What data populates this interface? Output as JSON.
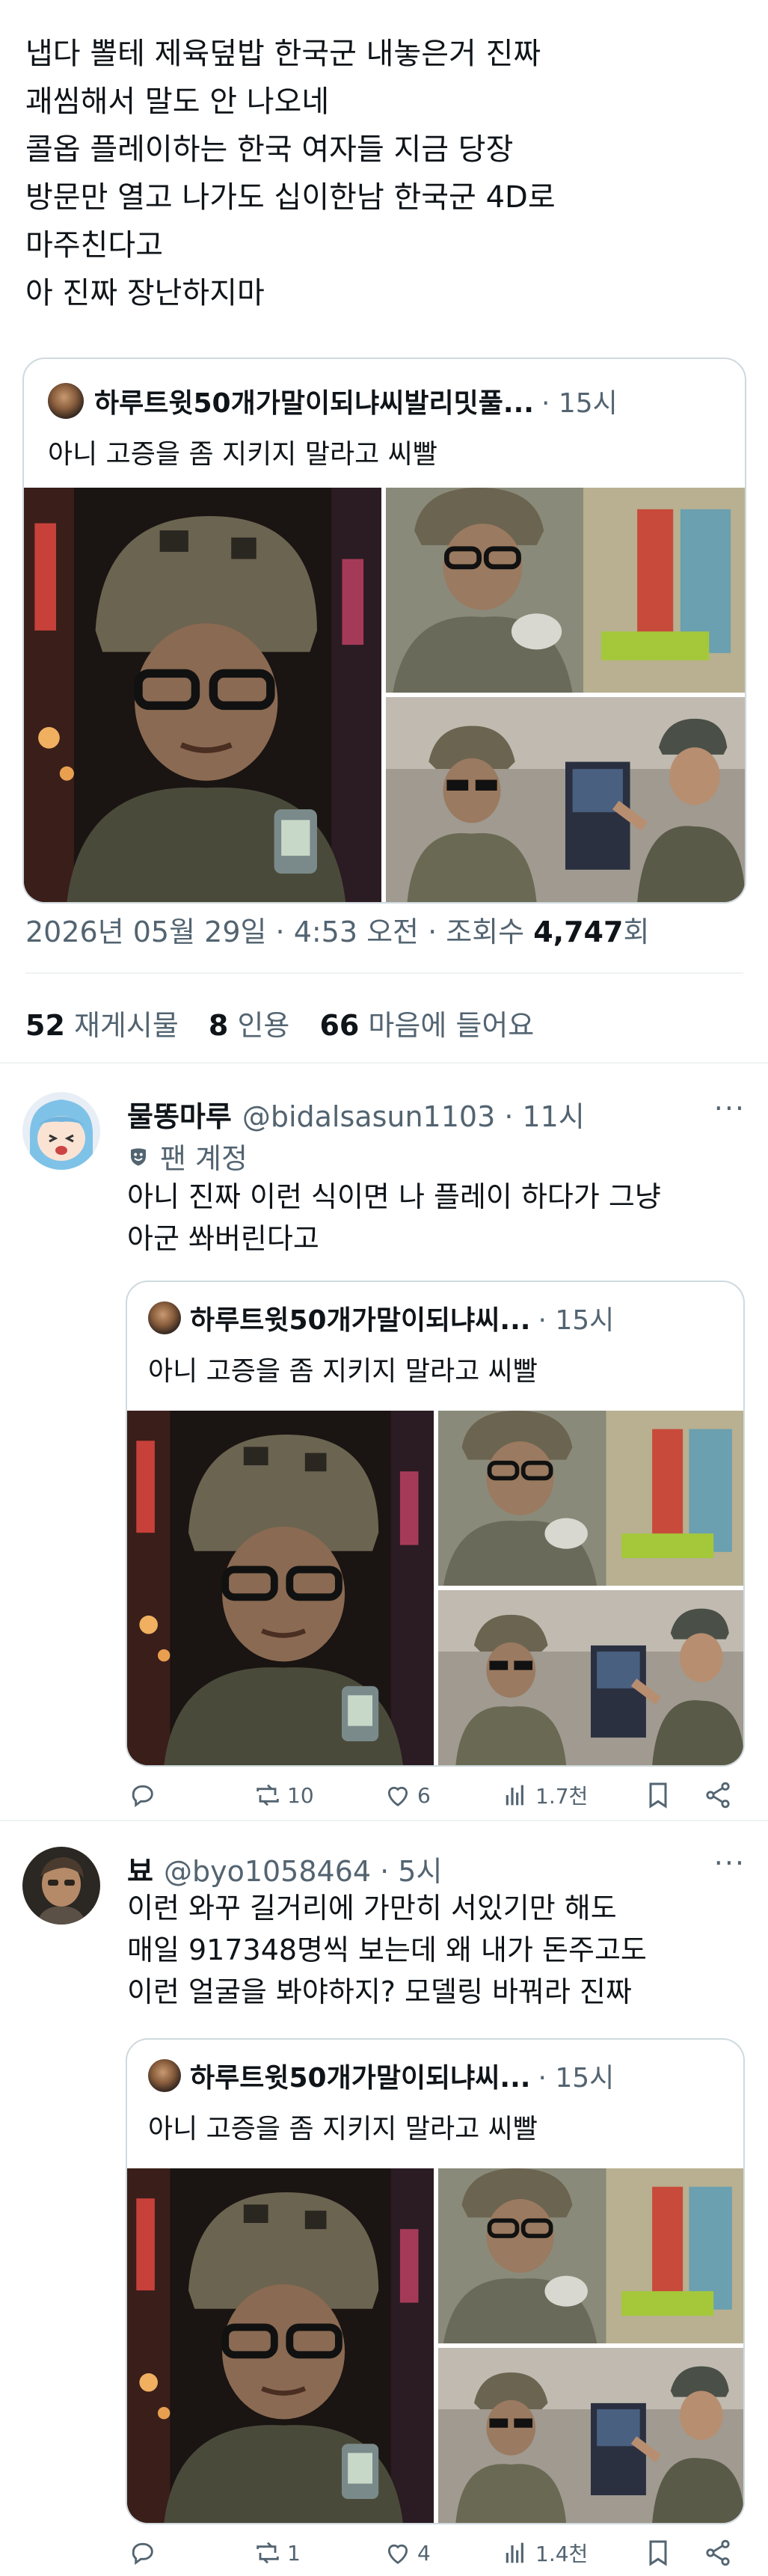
{
  "main_post": {
    "text_lines": [
      "냅다 뽈테 제육덮밥 한국군 내놓은거 진짜",
      "괘씸해서 말도 안 나오네",
      "콜옵 플레이하는 한국 여자들 지금 당장",
      "방문만 열고 나가도 십이한남 한국군 4D로",
      "마주친다고",
      "아 진짜 장난하지마"
    ],
    "quote": {
      "author": "하루트윗50개가말이되냐씨발리밋풀...",
      "time": "· 15시",
      "text": "아니 고증을 좀 지키지 말라고 씨빨"
    },
    "timestamp": "2026년 05월 29일 · 4:53 오전 · 조회수 ",
    "views": "4,747",
    "views_suffix": "회",
    "stats": [
      {
        "count": "52",
        "label": " 재게시물"
      },
      {
        "count": "8",
        "label": " 인용"
      },
      {
        "count": "66",
        "label": " 마음에 들어요"
      }
    ]
  },
  "replies": [
    {
      "name": "물똥마루",
      "handle": "@bidalsasun1103 · 11시",
      "badge": "팬 계정",
      "text_lines": [
        "아니 진짜 이런 식이면 나 플레이 하다가 그냥",
        "아군 쏴버린다고"
      ],
      "quote": {
        "author": "하루트윗50개가말이되냐씨...",
        "time": "· 15시",
        "text": "아니 고증을 좀 지키지 말라고 씨빨"
      },
      "actions": {
        "replies": "",
        "reposts": "10",
        "likes": "6",
        "views": "1.7천"
      }
    },
    {
      "name": "뵤",
      "handle": "@byo1058464 · 5시",
      "text_lines": [
        "이런 와꾸 길거리에 가만히 서있기만 해도",
        "매일 917348명씩 보는데 왜 내가 돈주고도",
        "이런 얼굴을 봐야하지? 모델링 바꿔라 진짜"
      ],
      "quote": {
        "author": "하루트윗50개가말이되냐씨...",
        "time": "· 15시",
        "text": "아니 고증을 좀 지키지 말라고 씨빨"
      },
      "actions": {
        "replies": "",
        "reposts": "1",
        "likes": "4",
        "views": "1.4천"
      }
    }
  ],
  "more_label": "···",
  "icons": [
    "reply-icon",
    "repost-icon",
    "like-icon",
    "views-icon",
    "bookmark-icon",
    "share-icon",
    "more-icon",
    "fan-badge-icon"
  ],
  "colors": {
    "text": "#0f1419",
    "secondary": "#536471",
    "border": "#cfd9de",
    "divider": "#eff3f4"
  }
}
